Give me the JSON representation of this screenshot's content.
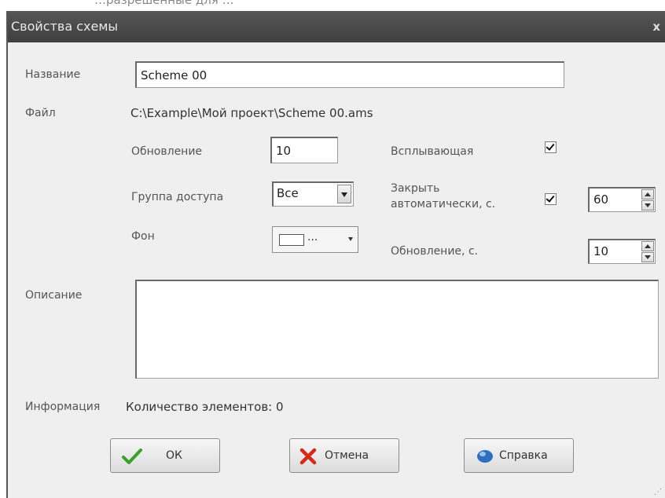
{
  "window": {
    "title": "Свойства схемы",
    "close_label": "x"
  },
  "top_fragment": "…разрешённые для …",
  "form": {
    "name_label": "Название",
    "name_value": "Scheme 00",
    "file_label": "Файл",
    "file_value": "C:\\Example\\Мой проект\\Scheme 00.ams",
    "refresh_label": "Обновление",
    "refresh_value": "10",
    "popup_label": "Всплывающая",
    "popup_checked": true,
    "access_group_label": "Группа доступа",
    "access_group_value": "Все",
    "auto_close_label_line1": "Закрыть",
    "auto_close_label_line2": "автоматически, с.",
    "auto_close_checked": true,
    "auto_close_value": "60",
    "background_label": "Фон",
    "background_value": "...",
    "refresh_sec_label": "Обновление, с.",
    "refresh_sec_value": "10",
    "description_label": "Описание",
    "description_value": "",
    "info_label": "Информация",
    "info_value": "Количество элементов: 0"
  },
  "buttons": {
    "ok": "ОК",
    "cancel": "Отмена",
    "help": "Справка"
  },
  "icons": {
    "ok": "checkmark-icon",
    "cancel": "red-x-icon",
    "help": "help-icon"
  },
  "colors": {
    "titlebar": "#4a4a4a",
    "ok_icon": "#3aa02a",
    "cancel_icon": "#d42a1a",
    "help_icon": "#2f6fc0"
  }
}
